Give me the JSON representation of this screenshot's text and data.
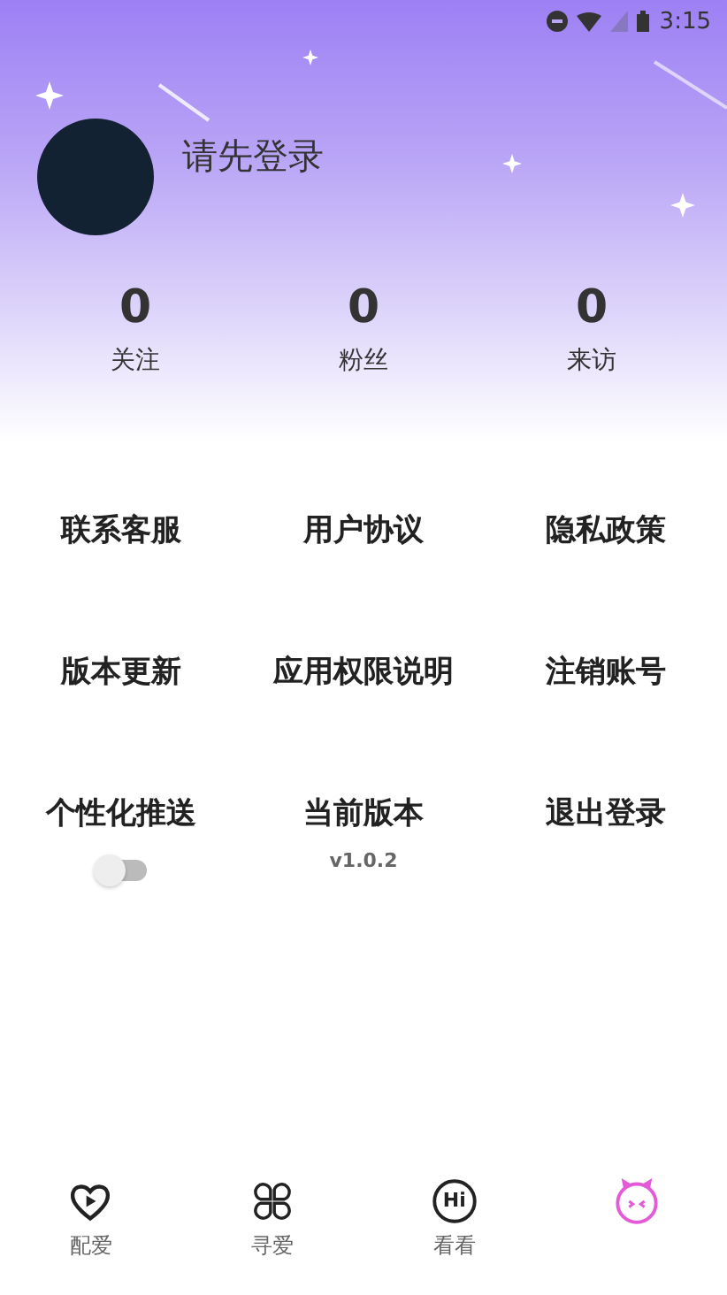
{
  "status_bar": {
    "time": "3:15"
  },
  "profile": {
    "name": "请先登录"
  },
  "stats": [
    {
      "value": "0",
      "label": "关注"
    },
    {
      "value": "0",
      "label": "粉丝"
    },
    {
      "value": "0",
      "label": "来访"
    }
  ],
  "menu": [
    {
      "label": "联系客服",
      "kind": "plain"
    },
    {
      "label": "用户协议",
      "kind": "plain"
    },
    {
      "label": "隐私政策",
      "kind": "plain"
    },
    {
      "label": "版本更新",
      "kind": "plain"
    },
    {
      "label": "应用权限说明",
      "kind": "plain"
    },
    {
      "label": "注销账号",
      "kind": "plain"
    },
    {
      "label": "个性化推送",
      "kind": "toggle",
      "on": false
    },
    {
      "label": "当前版本",
      "kind": "value",
      "value": "v1.0.2"
    },
    {
      "label": "退出登录",
      "kind": "plain"
    }
  ],
  "tabs": [
    {
      "label": "配爱",
      "kind": "heart",
      "selected": false
    },
    {
      "label": "寻爱",
      "kind": "clover",
      "selected": false
    },
    {
      "label": "看看",
      "kind": "hi",
      "icon_text": "Hi",
      "selected": false
    },
    {
      "kind": "face",
      "selected": true
    }
  ]
}
